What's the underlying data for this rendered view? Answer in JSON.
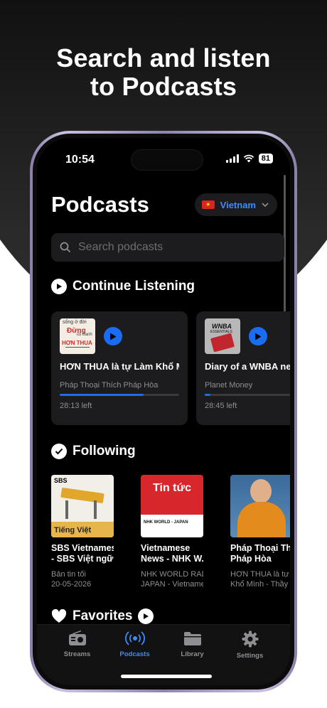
{
  "headline": {
    "line1": "Search and listen",
    "line2": "to Podcasts"
  },
  "status_bar": {
    "time": "10:54",
    "battery": "81"
  },
  "header": {
    "title": "Podcasts",
    "country": "Vietnam"
  },
  "search": {
    "placeholder": "Search podcasts"
  },
  "continue_listening": {
    "heading": "Continue Listening",
    "cards": [
      {
        "art_text_1": "sống ở đời",
        "art_text_2": "Đừng",
        "art_text_3": "cố tranh",
        "art_text_4": "HƠN THUA",
        "title": "HƠN THUA là tự Làm Khổ Mình - Thầy Thích Pháp Hòa",
        "author": "Pháp Thoại Thích Pháp Hòa",
        "progress_fraction": 0.7,
        "time_left": "28:13 left"
      },
      {
        "art_text_1": "WNBA",
        "art_text_2": "ESSENTIALS",
        "title": "Diary of a WNBA negotiation",
        "author": "Planet Money",
        "progress_fraction": 0.05,
        "time_left": "28:45 left"
      }
    ]
  },
  "following": {
    "heading": "Following",
    "items": [
      {
        "art_brand": "SBS",
        "art_label": "Tiếng Việt",
        "title_1": "SBS Vietnamese",
        "title_2": "- SBS Việt ngữ",
        "sub_1": "Bản tin tối",
        "sub_2": "20-05-2026"
      },
      {
        "art_label": "Tin tức",
        "art_brand": "NHK WORLD - JAPAN",
        "title_1": "Vietnamese",
        "title_2": "News - NHK W...",
        "sub_1": "NHK WORLD RADIO",
        "sub_2": "JAPAN - Vietnames..."
      },
      {
        "title_1": "Pháp Thoại Thích",
        "title_2": "Pháp Hòa",
        "sub_1": "HƠN THUA là tự",
        "sub_2": "Khổ Mình - Thầy"
      }
    ]
  },
  "favorites": {
    "heading": "Favorites"
  },
  "tabs": [
    {
      "label": "Streams",
      "icon": "radio-icon"
    },
    {
      "label": "Podcasts",
      "icon": "podcast-icon",
      "active": true
    },
    {
      "label": "Library",
      "icon": "folder-icon"
    },
    {
      "label": "Settings",
      "icon": "gear-icon"
    }
  ],
  "colors": {
    "accent": "#1a6cf0",
    "country_text": "#3b8cff",
    "card_bg": "#1c1c1e"
  }
}
